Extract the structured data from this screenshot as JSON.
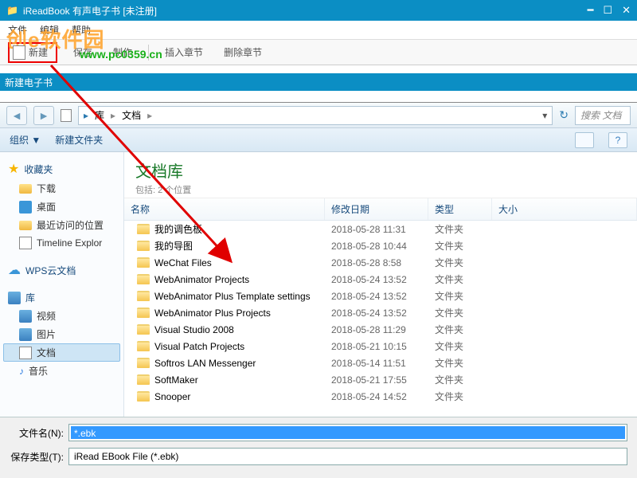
{
  "main_window": {
    "title": "iReadBook 有声电子书 [未注册]"
  },
  "menu": {
    "file": "文件",
    "edit": "编辑",
    "help": "帮助"
  },
  "watermark": {
    "text": "创e软件园",
    "url": "www.pc0359.cn"
  },
  "toolbar": {
    "new": "新建",
    "save": "保存",
    "make": "制作",
    "insert_chapter": "插入章节",
    "delete_chapter": "删除章节"
  },
  "subtitle": "新建电子书",
  "explorer": {
    "breadcrumb": {
      "root": "库",
      "current": "文档"
    },
    "search_placeholder": "搜索 文档",
    "toolbar": {
      "organize": "组织 ▼",
      "new_folder": "新建文件夹"
    },
    "library": {
      "title": "文档库",
      "subtitle": "包括: 2 个位置"
    },
    "columns": {
      "name": "名称",
      "date": "修改日期",
      "type": "类型",
      "size": "大小"
    },
    "sidebar": {
      "favorites": "收藏夹",
      "downloads": "下载",
      "desktop": "桌面",
      "recent": "最近访问的位置",
      "timeline": "Timeline Explor",
      "wps": "WPS云文档",
      "libraries": "库",
      "video": "视频",
      "pictures": "图片",
      "documents": "文档",
      "music": "音乐"
    },
    "files": [
      {
        "name": "我的调色板",
        "date": "2018-05-28 11:31",
        "type": "文件夹"
      },
      {
        "name": "我的导图",
        "date": "2018-05-28 10:44",
        "type": "文件夹"
      },
      {
        "name": "WeChat Files",
        "date": "2018-05-28 8:58",
        "type": "文件夹"
      },
      {
        "name": "WebAnimator Projects",
        "date": "2018-05-24 13:52",
        "type": "文件夹"
      },
      {
        "name": "WebAnimator Plus Template settings",
        "date": "2018-05-24 13:52",
        "type": "文件夹"
      },
      {
        "name": "WebAnimator Plus Projects",
        "date": "2018-05-24 13:52",
        "type": "文件夹"
      },
      {
        "name": "Visual Studio 2008",
        "date": "2018-05-28 11:29",
        "type": "文件夹"
      },
      {
        "name": "Visual Patch Projects",
        "date": "2018-05-21 10:15",
        "type": "文件夹"
      },
      {
        "name": "Softros LAN Messenger",
        "date": "2018-05-14 11:51",
        "type": "文件夹"
      },
      {
        "name": "SoftMaker",
        "date": "2018-05-21 17:55",
        "type": "文件夹"
      },
      {
        "name": "Snooper",
        "date": "2018-05-24 14:52",
        "type": "文件夹"
      }
    ]
  },
  "bottom": {
    "filename_label": "文件名(N):",
    "filename_value": "*.ebk",
    "savetype_label": "保存类型(T):",
    "savetype_value": "iRead EBook File (*.ebk)"
  }
}
